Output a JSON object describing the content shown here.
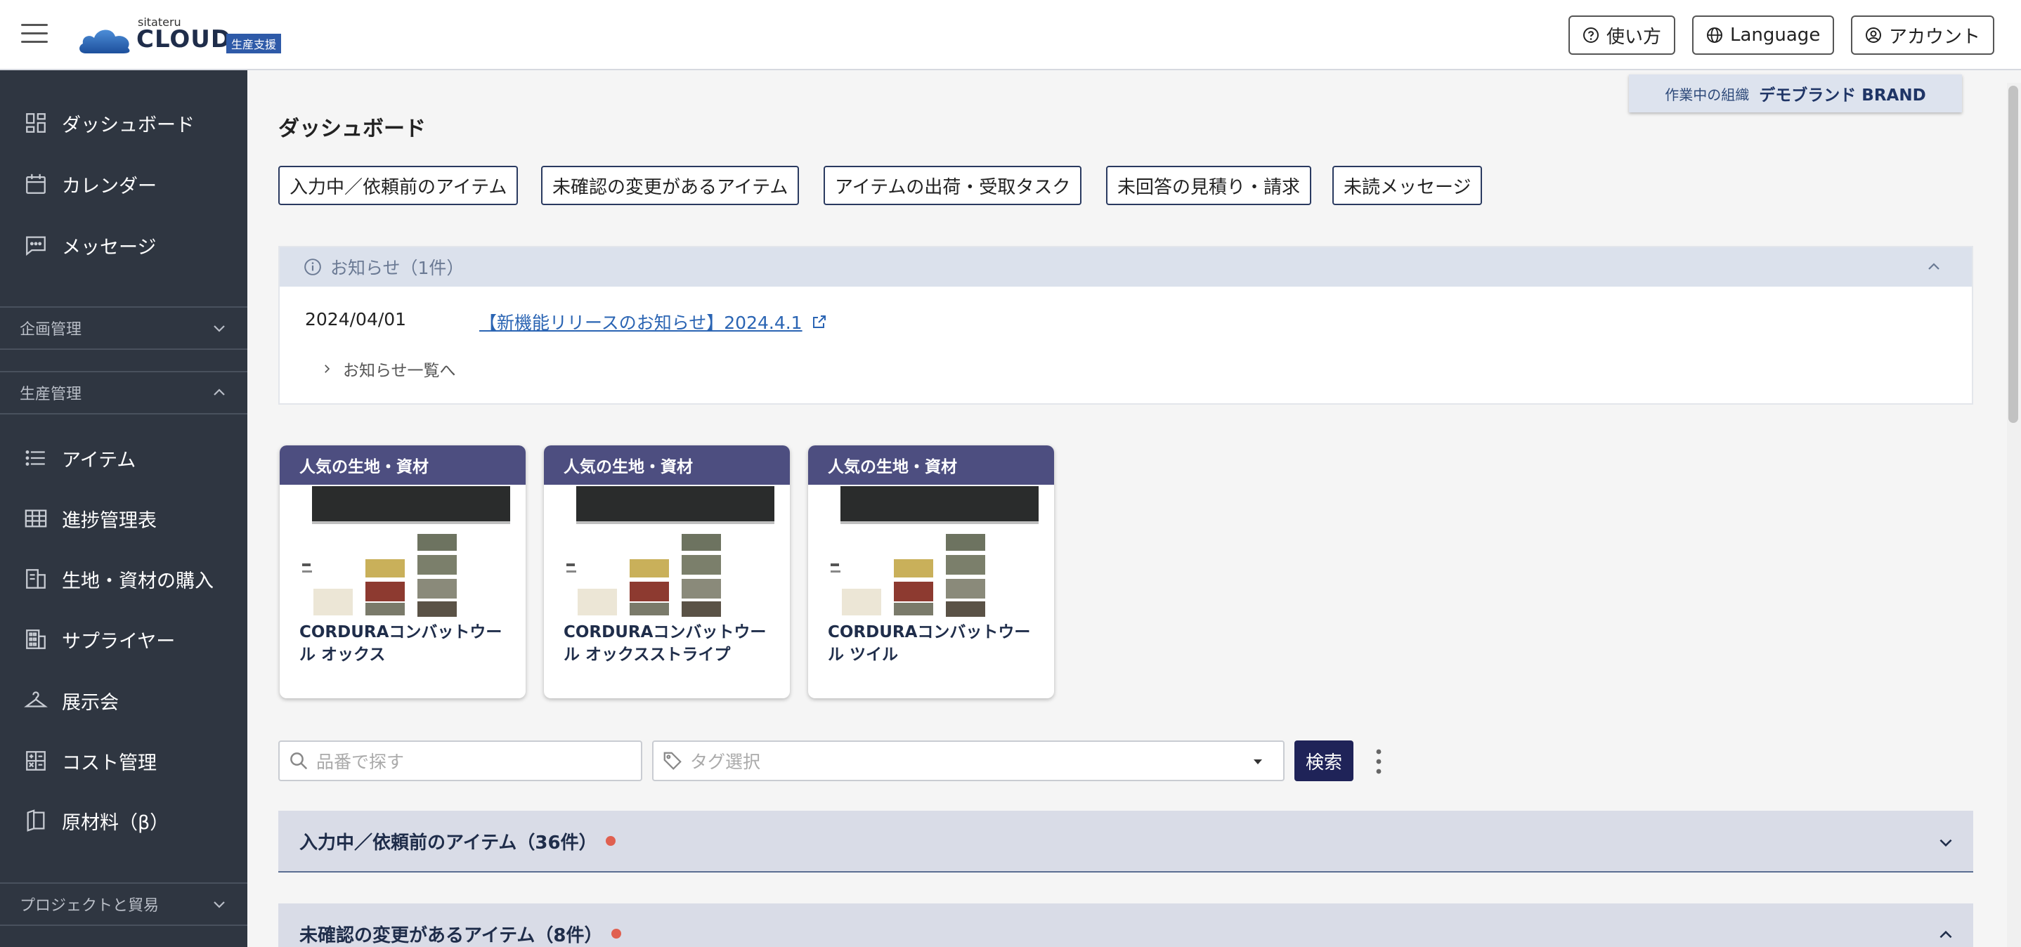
{
  "header": {
    "logo_small": "sitateru",
    "logo_text": "CLOUD",
    "logo_badge": "生産支援",
    "help_label": "使い方",
    "language_label": "Language",
    "account_label": "アカウント"
  },
  "sidebar": {
    "top_items": [
      {
        "label": "ダッシュボード",
        "icon": "dashboard-icon"
      },
      {
        "label": "カレンダー",
        "icon": "calendar-icon"
      },
      {
        "label": "メッセージ",
        "icon": "message-icon"
      }
    ],
    "section_planning": "企画管理",
    "section_production": "生産管理",
    "production_items": [
      {
        "label": "アイテム",
        "icon": "list-icon"
      },
      {
        "label": "進捗管理表",
        "icon": "grid-icon"
      },
      {
        "label": "生地・資材の購入",
        "icon": "purchase-icon"
      },
      {
        "label": "サプライヤー",
        "icon": "building-icon"
      },
      {
        "label": "展示会",
        "icon": "hanger-icon"
      },
      {
        "label": "コスト管理",
        "icon": "calculator-icon"
      },
      {
        "label": "原材料（β）",
        "icon": "book-icon"
      }
    ],
    "section_project": "プロジェクトと貿易"
  },
  "org": {
    "label": "作業中の組織",
    "name": "デモブランド BRAND"
  },
  "page_title": "ダッシュボード",
  "filters": [
    "入力中／依頼前のアイテム",
    "未確認の変更があるアイテム",
    "アイテムの出荷・受取タスク",
    "未回答の見積り・請求",
    "未読メッセージ"
  ],
  "notice": {
    "title": "お知らせ（1件）",
    "date": "2024/04/01",
    "link_text": "【新機能リリースのお知らせ】2024.4.1",
    "more_label": "お知らせ一覧へ"
  },
  "cards": [
    {
      "tag": "人気の生地・資材",
      "name": "CORDURAコンバットウール オックス"
    },
    {
      "tag": "人気の生地・資材",
      "name": "CORDURAコンバットウール オックスストライプ"
    },
    {
      "tag": "人気の生地・資材",
      "name": "CORDURAコンバットウール ツイル"
    }
  ],
  "search": {
    "part_placeholder": "品番で探す",
    "tag_placeholder": "タグ選択",
    "button_label": "検索"
  },
  "accordions": [
    {
      "label": "入力中／依頼前のアイテム（36件）",
      "expanded": false
    },
    {
      "label": "未確認の変更があるアイテム（8件）",
      "expanded": true
    }
  ],
  "colors": {
    "sidebar_bg": "#2f3641",
    "card_header": "#4d4e80",
    "search_button": "#1f2358",
    "alert_dot": "#e06050"
  }
}
